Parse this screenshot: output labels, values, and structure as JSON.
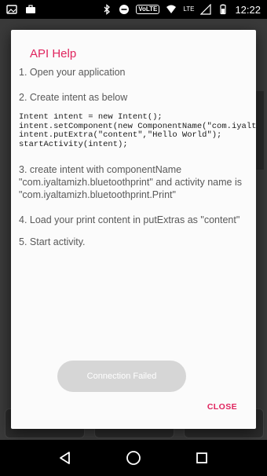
{
  "status_bar": {
    "volte_label": "VoLTE",
    "lte_label": "LTE",
    "time": "12:22"
  },
  "dialog": {
    "title": "API Help",
    "steps": [
      "1. Open your application",
      "2. Create intent as below",
      "3. create intent with componentName \"com.iyaltamizh.bluetoothprint\" and activity name is \"com.iyaltamizh.bluetoothprint.Print\"",
      "4. Load your print content in putExtras as \"content\"",
      "5. Start activity."
    ],
    "code_lines": [
      "Intent intent = new Intent();",
      "intent.setComponent(new ComponentName(\"com.iyaltamizh.bluetoothprint\",\"com.iyaltamizh.bluetoothprint.Print\"));",
      "intent.putExtra(\"content\",\"Hello World\");",
      "startActivity(intent);"
    ],
    "close_label": "CLOSE"
  },
  "toast": {
    "message": "Connection Failed"
  },
  "colors": {
    "accent": "#e0245e",
    "body_text": "#595959",
    "code_text": "#1a1a1a",
    "toast_bg": "#d6d6d6"
  }
}
